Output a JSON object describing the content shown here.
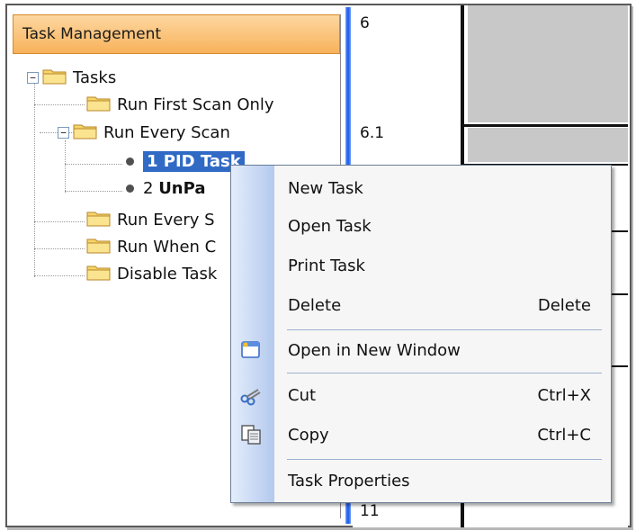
{
  "panel": {
    "title": "Task Management"
  },
  "tree": {
    "root_label": "Tasks",
    "run_first_scan": "Run First Scan Only",
    "run_every_scan": "Run Every Scan",
    "task_1": "1 PID Task",
    "task_2_num": "2",
    "task_2_name": "UnPa",
    "run_every_s": "Run Every S",
    "run_when": "Run When C",
    "disable_task": "Disable Task"
  },
  "grid": {
    "rung_labels": [
      "6",
      "6.1",
      "11"
    ]
  },
  "menu": {
    "new_task": "New Task",
    "open_task": "Open Task",
    "print_task": "Print Task",
    "delete": "Delete",
    "delete_shortcut": "Delete",
    "open_new_window": "Open in New Window",
    "cut": "Cut",
    "cut_shortcut": "Ctrl+X",
    "copy": "Copy",
    "copy_shortcut": "Ctrl+C",
    "task_properties": "Task Properties"
  },
  "icons": {
    "folder": "folder-icon",
    "task": "task-bullet-icon",
    "new_window": "new-window-icon",
    "cut": "scissors-icon",
    "copy": "copy-icon"
  },
  "colors": {
    "header_orange": "#f8b25b",
    "selection_blue": "#316ac5",
    "splitter_blue": "#1c56e6"
  }
}
